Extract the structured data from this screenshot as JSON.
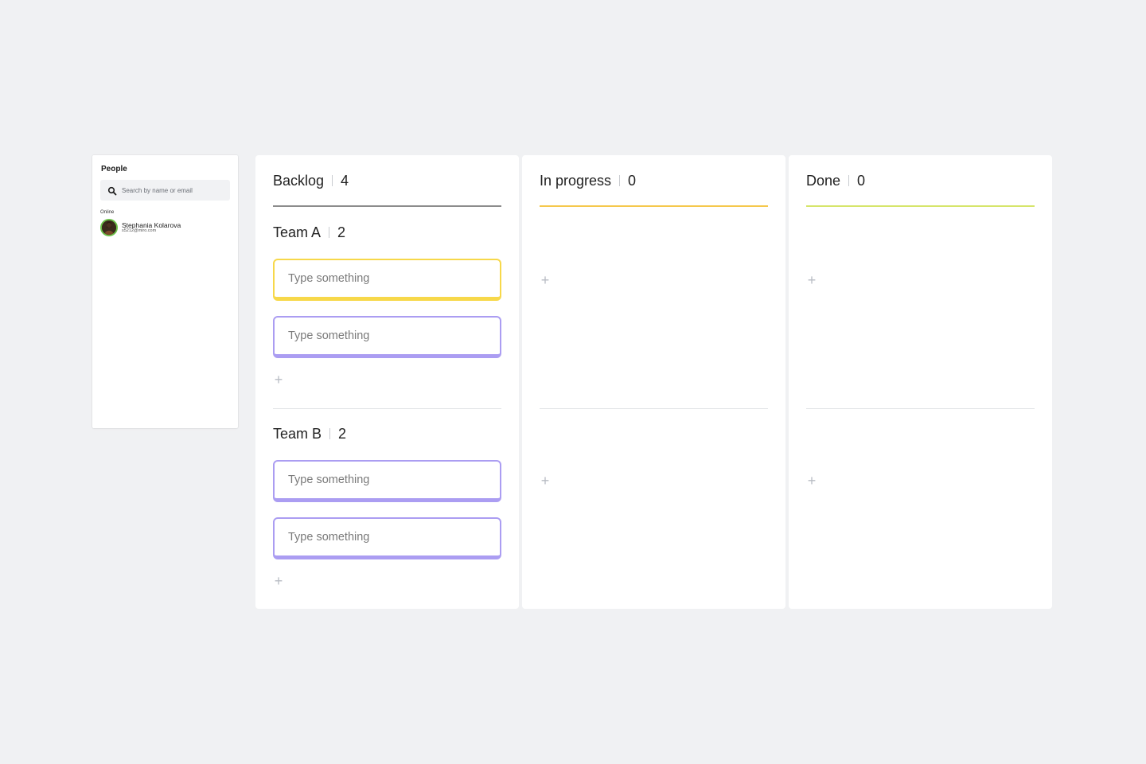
{
  "people_panel": {
    "title": "People",
    "search_placeholder": "Search by name or email",
    "section_label": "Online",
    "users": [
      {
        "name": "Stephania Kolarova",
        "email": "s5212@miro.com"
      }
    ]
  },
  "colors": {
    "backlog_underline": "#8c8c8c",
    "in_progress_underline": "#f5c84c",
    "done_underline": "#d6e56a",
    "card_yellow": "#f7d84a",
    "card_purple": "#ab9df2",
    "online_ring": "#6cc04a"
  },
  "board": {
    "columns": [
      {
        "title": "Backlog",
        "count": "4",
        "lanes": [
          {
            "title": "Team A",
            "count": "2",
            "cards": [
              "Type something",
              "Type something"
            ]
          },
          {
            "title": "Team B",
            "count": "2",
            "cards": [
              "Type something",
              "Type something"
            ]
          }
        ]
      },
      {
        "title": "In progress",
        "count": "0"
      },
      {
        "title": "Done",
        "count": "0"
      }
    ]
  },
  "icons": {
    "search": "search-icon",
    "add": "plus-icon"
  },
  "add_glyph": "+"
}
